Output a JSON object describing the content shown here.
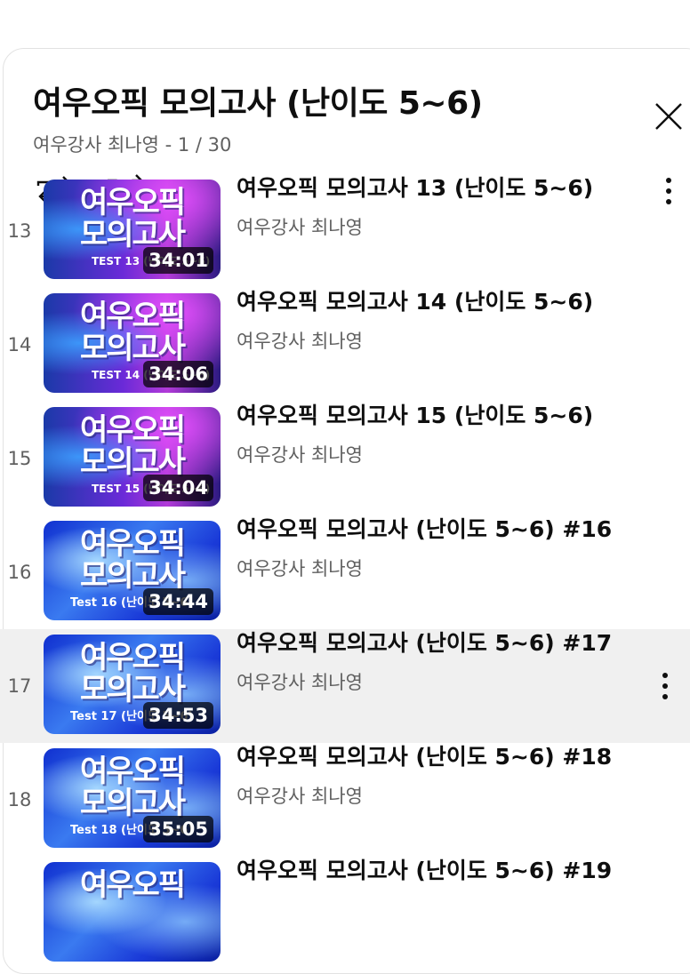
{
  "playlist": {
    "title": "여우오픽 모의고사 (난이도 5~6)",
    "meta": "여우강사 최나영 - 1 / 30"
  },
  "controls": {
    "icons": [
      "loop-icon",
      "shuffle-icon",
      "more-vert-icon",
      "close-icon"
    ]
  },
  "items": [
    {
      "index": "13",
      "title": "여우오픽 모의고사 13 (난이도 5~6)",
      "channel": "여우강사 최나영",
      "duration": "34:01",
      "thumb_title": "여우오픽\n모의고사",
      "thumb_sub": "TEST 13 (난이도 5~6)",
      "style": "purple",
      "active": false
    },
    {
      "index": "14",
      "title": "여우오픽 모의고사 14 (난이도 5~6)",
      "channel": "여우강사 최나영",
      "duration": "34:06",
      "thumb_title": "여우오픽\n모의고사",
      "thumb_sub": "TEST 14 (난이도 5~6)",
      "style": "purple",
      "active": false
    },
    {
      "index": "15",
      "title": "여우오픽 모의고사 15 (난이도 5~6)",
      "channel": "여우강사 최나영",
      "duration": "34:04",
      "thumb_title": "여우오픽\n모의고사",
      "thumb_sub": "TEST 15 (난이도 5~6)",
      "style": "purple",
      "active": false
    },
    {
      "index": "16",
      "title": "여우오픽 모의고사 (난이도 5~6) #16",
      "channel": "여우강사 최나영",
      "duration": "34:44",
      "thumb_title": "여우오픽\n모의고사",
      "thumb_sub": "Test 16 (난이도 5~6)",
      "style": "blue",
      "active": false
    },
    {
      "index": "17",
      "title": "여우오픽 모의고사 (난이도 5~6) #17",
      "channel": "여우강사 최나영",
      "duration": "34:53",
      "thumb_title": "여우오픽\n모의고사",
      "thumb_sub": "Test 17 (난이도 5~6)",
      "style": "blue",
      "active": true
    },
    {
      "index": "18",
      "title": "여우오픽 모의고사 (난이도 5~6) #18",
      "channel": "여우강사 최나영",
      "duration": "35:05",
      "thumb_title": "여우오픽\n모의고사",
      "thumb_sub": "Test 18 (난이도 5~6)",
      "style": "blue",
      "active": false
    },
    {
      "index": "",
      "title": "여우오픽 모의고사 (난이도 5~6) #19",
      "channel": "",
      "duration": "",
      "thumb_title": "여우오픽",
      "thumb_sub": "",
      "style": "blue",
      "active": false
    }
  ],
  "colors": {
    "text": "#0f0f0f",
    "secondary": "#606060",
    "active_row": "#f0f0f0",
    "border": "#e2e2e2"
  }
}
